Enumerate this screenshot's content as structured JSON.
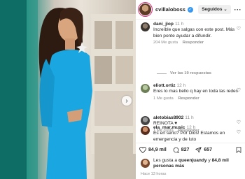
{
  "post": {
    "username": "cvillaloboss",
    "follow_label": "Seguidos"
  },
  "comments": [
    {
      "username": "dani_jiop",
      "time": "11 h",
      "text": "Increíble que salgas con este post. Más bien ponte ayudar a difundir.",
      "likes": "204 Me gusta",
      "reply": "Responder",
      "view_replies": "Ver las 19 respuestas"
    },
    {
      "username": "eliott.ortiz",
      "time": "12 h",
      "text": "Eres lo mas bello q hay en toda las redes",
      "likes": "1 Me gusta",
      "reply": "Responder"
    },
    {
      "username": "aletobias8902",
      "time": "11 h",
      "text": "REINOTA ♥",
      "likes": "1 Me gusta",
      "reply": "Responder"
    },
    {
      "username": "ela_mar.music",
      "time": "12 h",
      "text": "Es en serio? Por Dios! Estamos en emergencia y de luto"
    }
  ],
  "actions": {
    "likes": "84,9 mil",
    "comments": "827",
    "shares": "657"
  },
  "liked_by": {
    "prefix": "Les gusta a",
    "user": "queenjuandy",
    "connector": "y",
    "others": "84,8 mil personas más"
  },
  "timestamp": "Hace 13 horas",
  "colors": {
    "dress": "#1aa6e0",
    "verified": "#3897f0"
  }
}
